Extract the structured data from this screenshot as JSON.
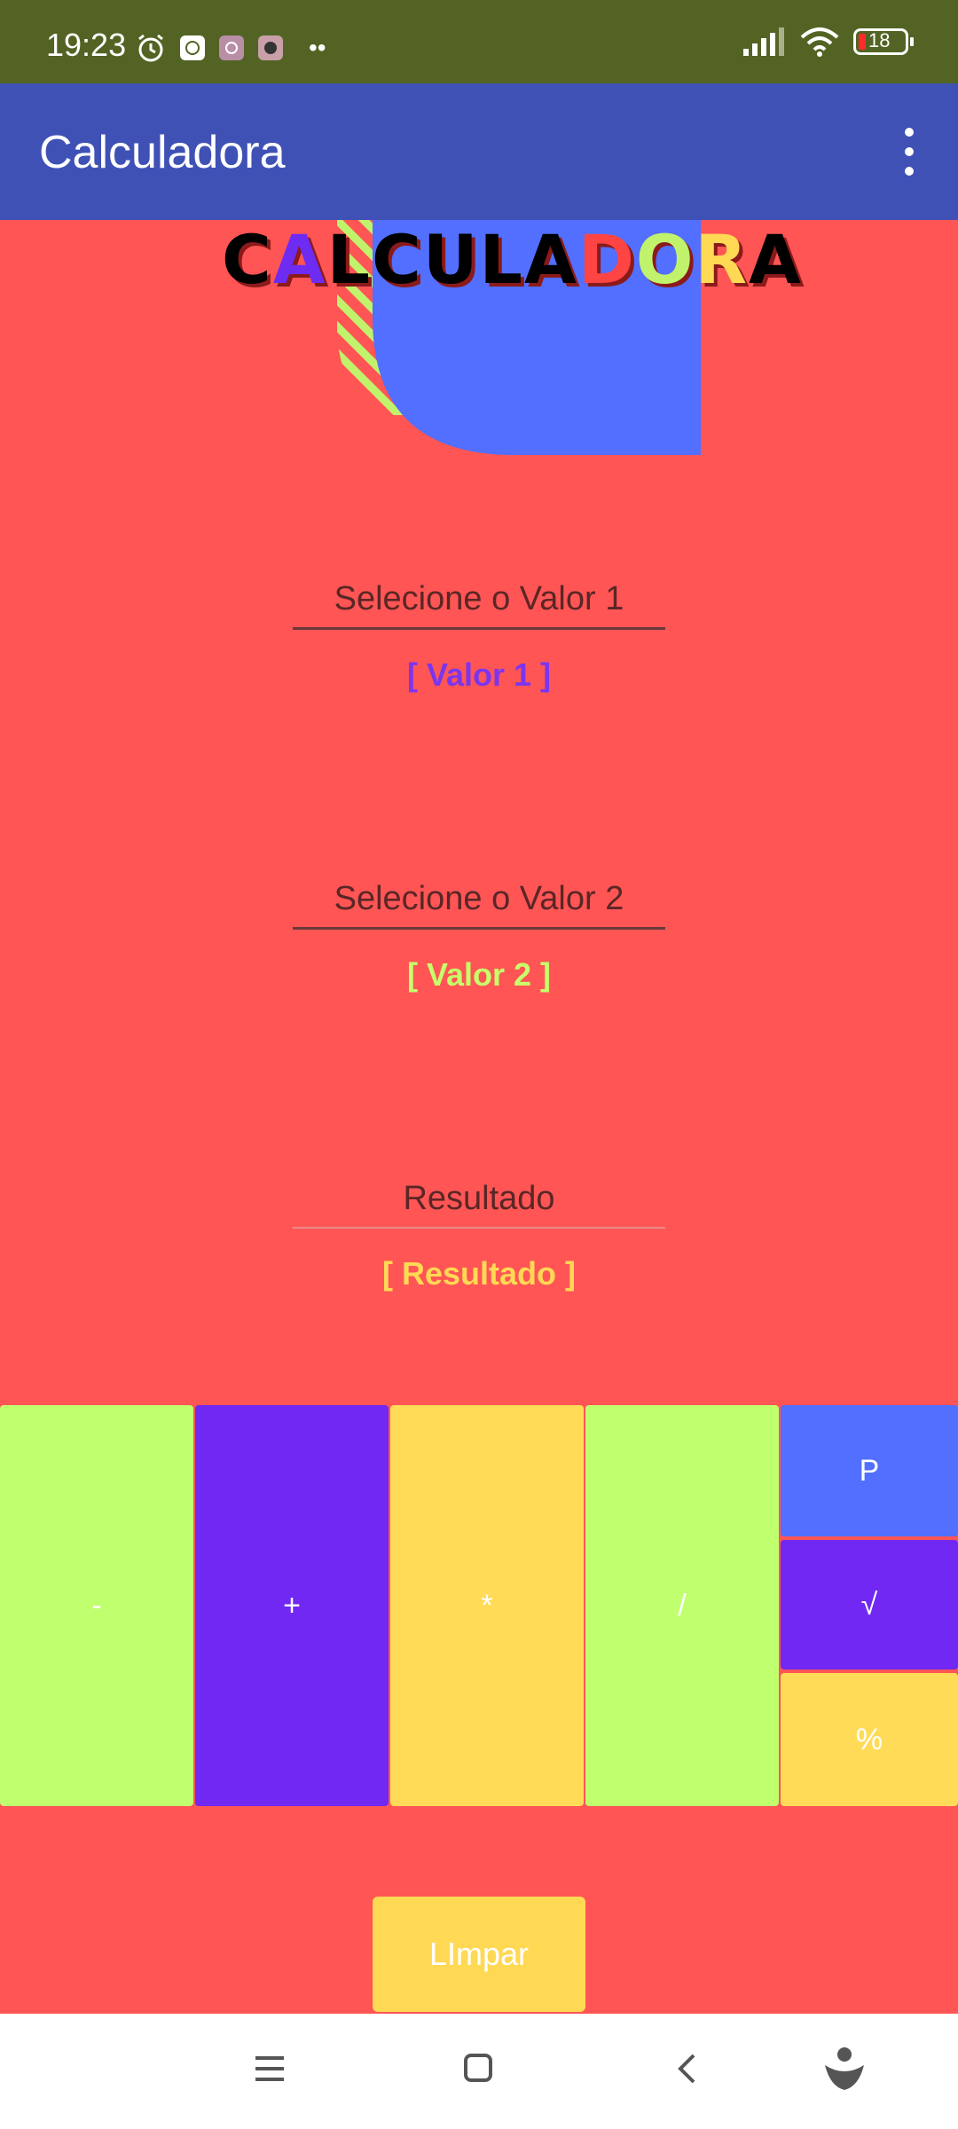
{
  "status_bar": {
    "time": "19:23",
    "battery": "18",
    "more_dots": "••"
  },
  "app_bar": {
    "title": "Calculadora",
    "menu_icon": "more-vertical-icon"
  },
  "logo": {
    "letters": [
      "C",
      "A",
      "L",
      "C",
      "U",
      "L",
      "A",
      "D",
      "O",
      "R",
      "A"
    ],
    "colors": [
      "#000000",
      "#6E2BF2",
      "#000000",
      "#000000",
      "#000000",
      "#000000",
      "#000000",
      "#FF4444",
      "#C0F26C",
      "#FFD954",
      "#000000"
    ]
  },
  "fields": {
    "value1": {
      "hint": "Selecione o Valor 1",
      "value": "[ Valor 1 ]",
      "color": "#7B35F0"
    },
    "value2": {
      "hint": "Selecione o Valor 2",
      "value": "[ Valor 2 ]",
      "color": "#C6FF6A"
    },
    "result": {
      "hint": "Resultado",
      "value": "[ Resultado ]",
      "color": "#FFD954"
    }
  },
  "keypad": {
    "minus": {
      "label": "-",
      "color": "#C0FF6E"
    },
    "plus": {
      "label": "+",
      "color": "#7028F2"
    },
    "multiply": {
      "label": "*",
      "color": "#FFDB58"
    },
    "divide": {
      "label": "/",
      "color": "#C0FF6E"
    },
    "power": {
      "label": "P",
      "color": "#526FFF"
    },
    "sqrt": {
      "label": "√",
      "color": "#7028F2"
    },
    "percent": {
      "label": "%",
      "color": "#FFDB58"
    }
  },
  "clear_button": {
    "label": "LImpar"
  },
  "nav_bar": {
    "icons": [
      "menu-icon",
      "home-square-icon",
      "back-chevron-icon",
      "assistant-icon"
    ]
  },
  "colors": {
    "background": "#FF5555",
    "status_bar": "#536324",
    "app_bar": "#3F51B5"
  }
}
